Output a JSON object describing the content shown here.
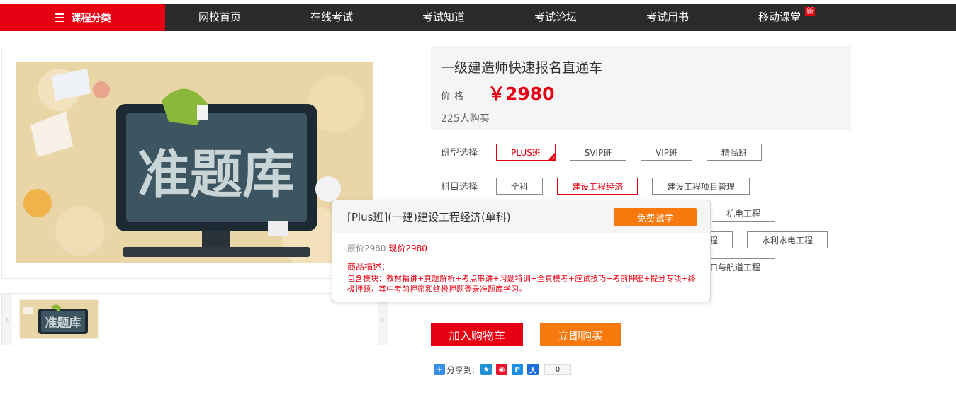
{
  "nav": {
    "category_label": "课程分类",
    "items": [
      "网校首页",
      "在线考试",
      "考试知道",
      "考试论坛",
      "考试用书",
      "移动课堂"
    ],
    "new_badge": "新"
  },
  "product_image": {
    "text": "准题库"
  },
  "product": {
    "title": "一级建造师快速报名直通车",
    "price_label": "价格",
    "price": "￥2980",
    "buyers": "225人购买"
  },
  "options": {
    "class_label": "班型选择",
    "class_items": [
      "PLUS班",
      "SVIP班",
      "VIP班",
      "精品班"
    ],
    "subject_label": "科目选择",
    "subject_items": [
      "全科",
      "建设工程经济",
      "建设工程项目管理",
      "机电工程",
      "程",
      "水利水电工程",
      "口与航道工程"
    ]
  },
  "popup": {
    "title": "[Plus班](一建)建设工程经济(单科)",
    "trial_button": "免费试学",
    "orig_price": "原价2980",
    "now_price": "现价2980",
    "desc_label": "商品描述：",
    "desc_text": "包含模块：教材精讲+真题解析+考点串讲+习题特训+全真模考+应试技巧+考前押密+提分专项+终极押题，其中考前押密和终极押题登录准题库学习。"
  },
  "actions": {
    "add_cart": "加入购物车",
    "buy_now": "立即购买"
  },
  "share": {
    "label": "分享到:",
    "count": "0"
  },
  "colors": {
    "brand_red": "#e60012",
    "orange": "#f7780c",
    "nav_dark": "#2b2b2b"
  }
}
